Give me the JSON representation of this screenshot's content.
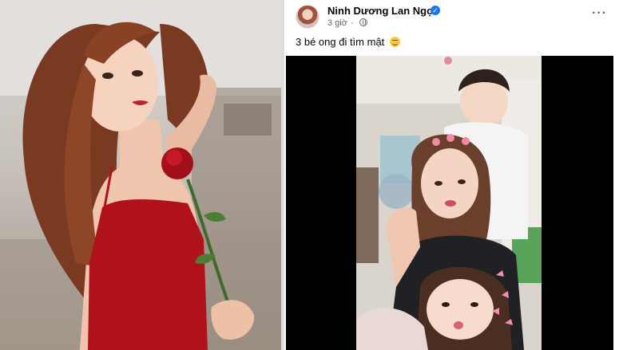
{
  "post": {
    "author_name": "Ninh Dương Lan Ngọc",
    "timestamp": "3 giờ",
    "privacy_icon": "globe-icon",
    "caption": "3 bé ong đi tìm mật",
    "caption_emoji": "grinning-face-emoji",
    "more_options_icon": "more-options-icon",
    "more_label": "···",
    "verified_icon": "verified-badge-icon",
    "verified_glyph": "✓"
  },
  "colors": {
    "brand_blue": "#1877f2",
    "dress_red": "#b0121c",
    "text_primary": "#050505",
    "text_secondary": "#65676b"
  }
}
